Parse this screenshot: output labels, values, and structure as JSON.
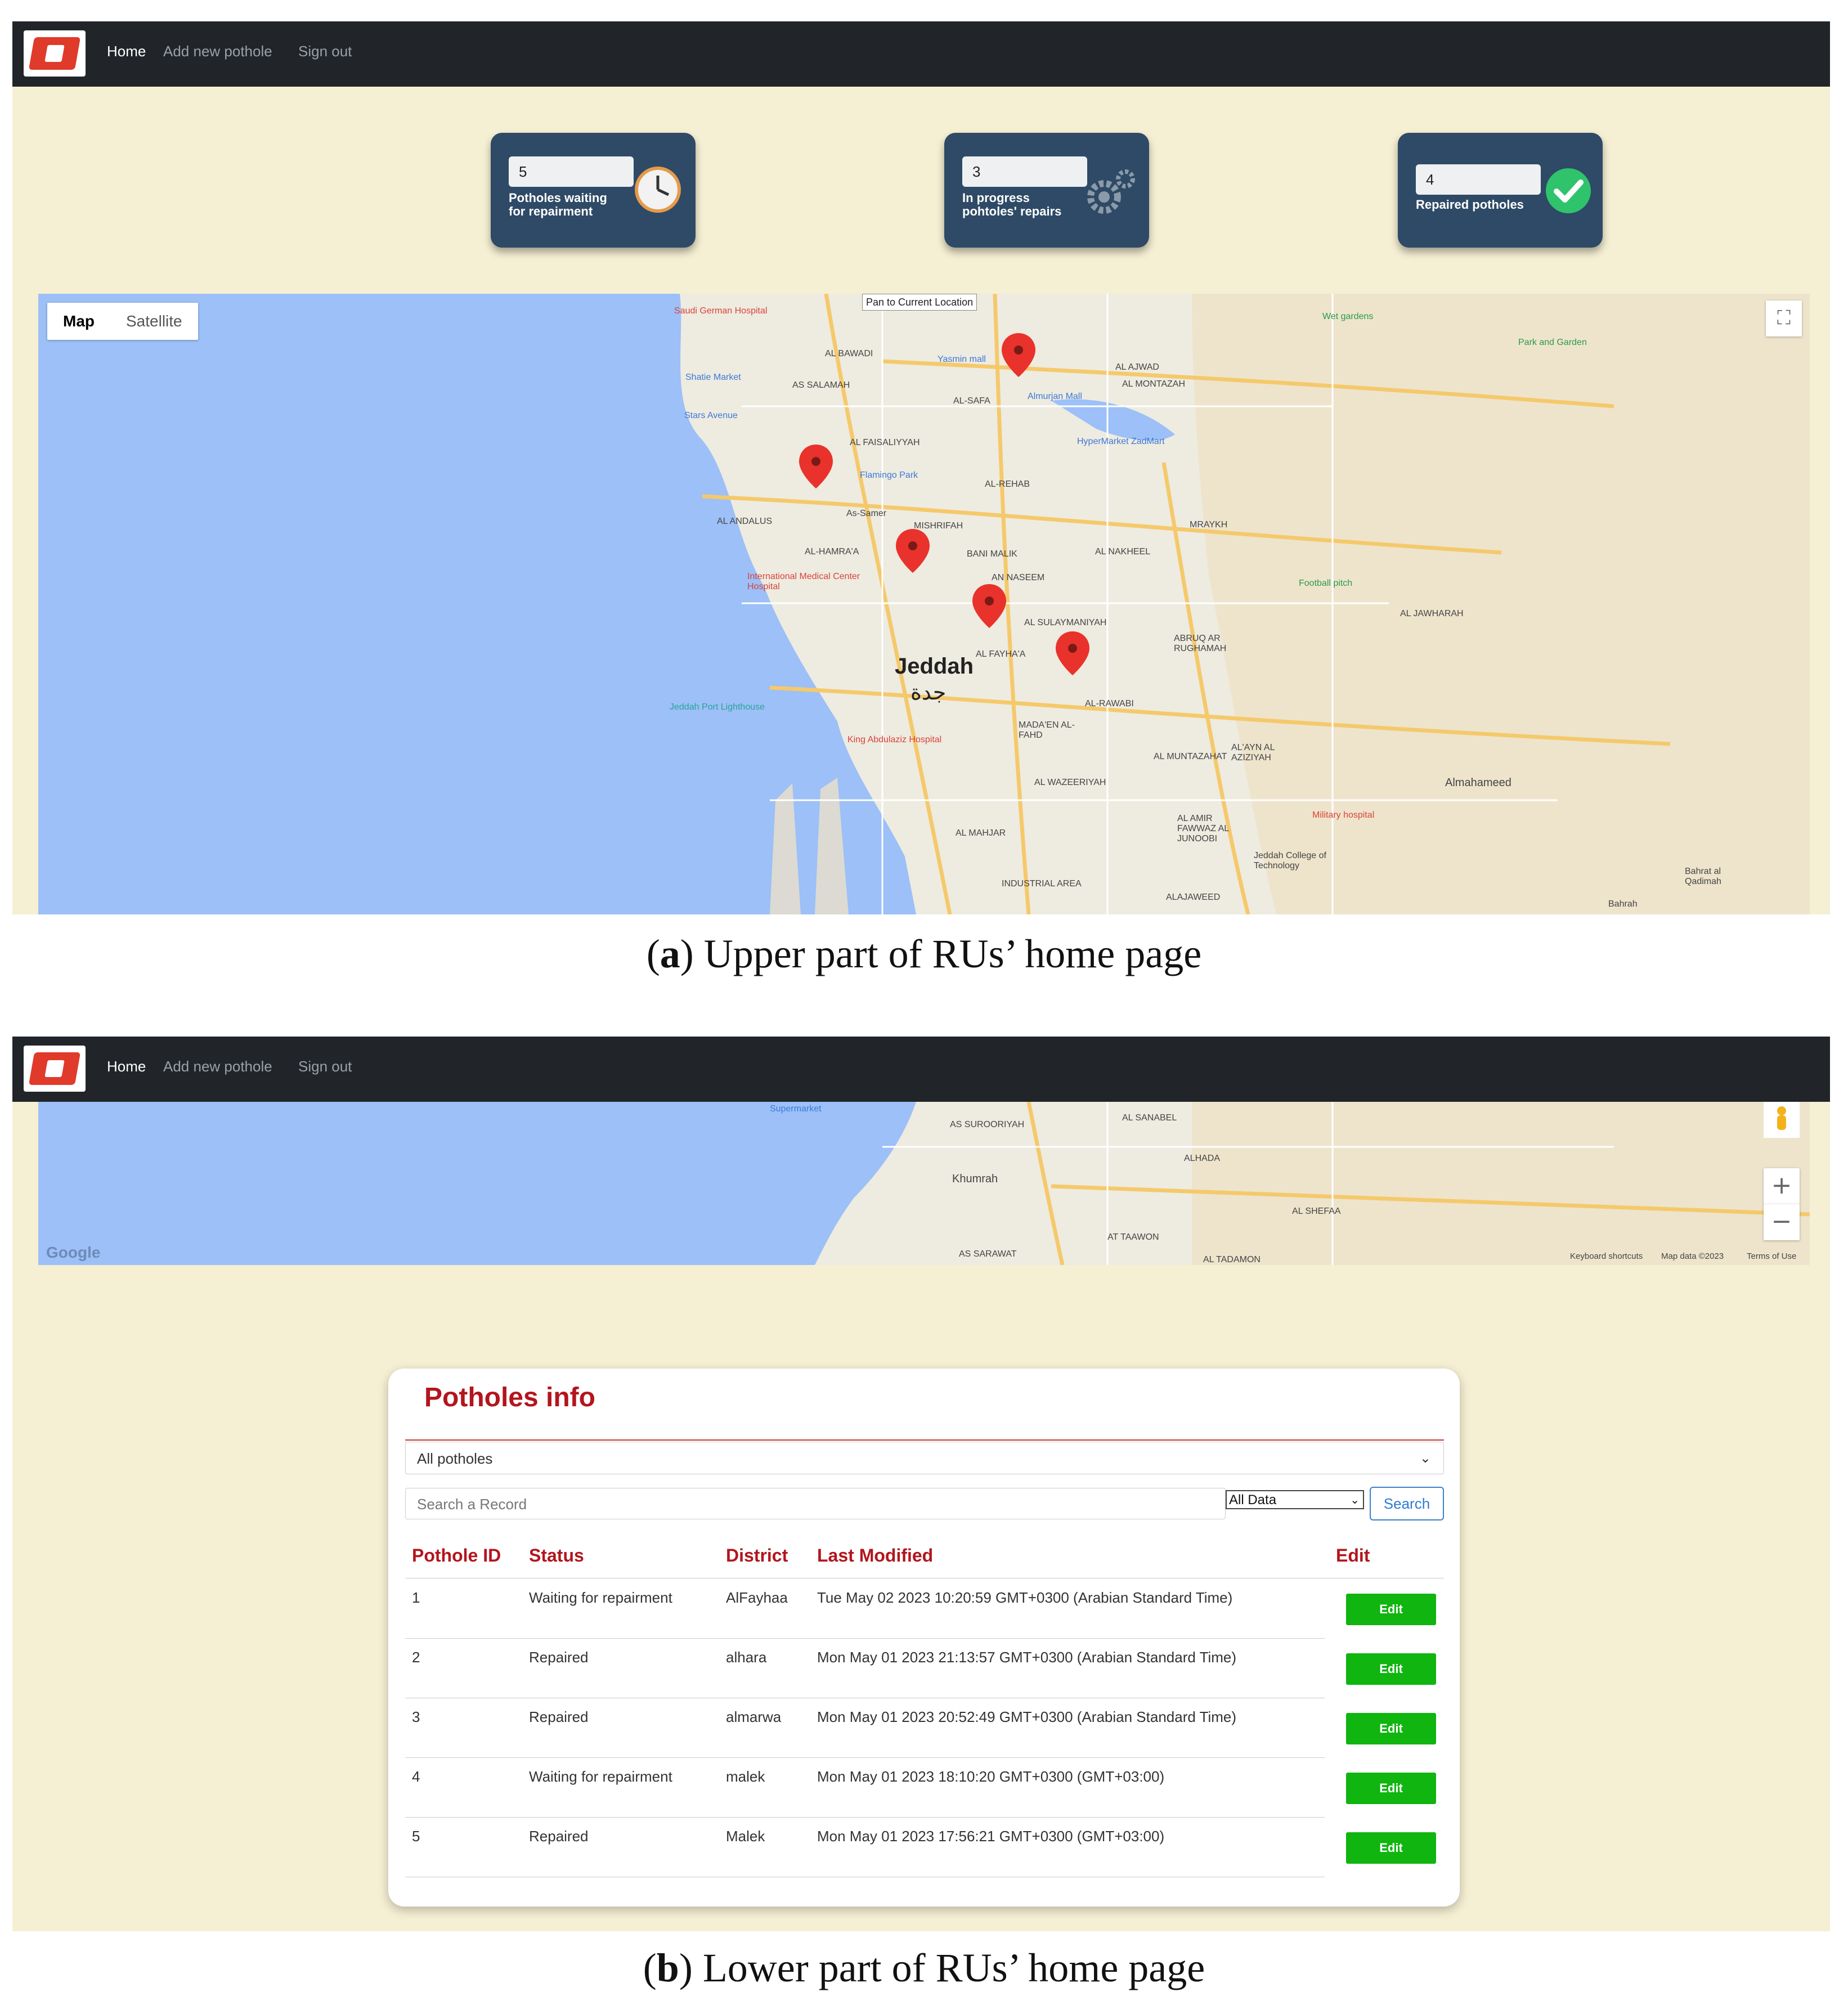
{
  "nav": {
    "home": "Home",
    "add": "Add new pothole",
    "signout": "Sign out"
  },
  "cards": [
    {
      "count": "5",
      "label": "Potholes waiting for repairment",
      "icon": "clock-icon"
    },
    {
      "count": "3",
      "label": "In progress pohtoles' repairs",
      "icon": "gears-icon"
    },
    {
      "count": "4",
      "label": "Repaired potholes",
      "icon": "check-icon"
    }
  ],
  "map": {
    "type_map": "Map",
    "type_satellite": "Satellite",
    "pan_label": "Pan to Current Location",
    "city_en": "Jeddah",
    "city_ar": "جدة",
    "places": [
      "Saudi German Hospital",
      "Shatie Market",
      "Stars Avenue",
      "AL BAWADI",
      "AS SALAMAH",
      "Yasmin mall",
      "Almurjan Mall",
      "AL-SAFA",
      "AL FAISALIYYAH",
      "Flamingo Park",
      "AL-REHAB",
      "HyperMarket ZadMart",
      "As-Samer",
      "AL ANDALUS",
      "MISHRIFAH",
      "AL-HAMRA'A",
      "International Medical Center Hospital",
      "AN NASEEM",
      "BANI MALIK",
      "AL SULAYMANIYAH",
      "AL FAYHA'A",
      "Jeddah Port Lighthouse",
      "AL-RAWABI",
      "MADA'EN AL-FAHD",
      "King Abdulaziz Hospital",
      "AL WAZEERIYAH",
      "AL MAHJAR",
      "INDUSTRIAL AREA",
      "Almahameed",
      "Jeddah College of Technology",
      "Military hospital",
      "Bahrat al Qadimah",
      "Bahrah",
      "Wet gardens",
      "Park and Garden",
      "Football pitch",
      "AL AJWAD",
      "AL MONTAZAH",
      "MRAYKH",
      "AL NAKHEEL",
      "AL MUNTAZAHAT",
      "AL'AYN AL AZIZIYAH",
      "ABRUQ AR RUGHAMAH",
      "AL JAWHARAH",
      "AL AMIR FAWWAZ AL JUNOOBI",
      "ALAJAWEED"
    ],
    "lower_places": [
      "Supermarket",
      "AS SUROORIYAH",
      "Khumrah",
      "AS SARAWAT",
      "AL SANABEL",
      "ALHADA",
      "AL SHEFAA",
      "AT TAAWON",
      "AL TADAMON"
    ],
    "google": "Google",
    "footer_shortcuts": "Keyboard shortcuts",
    "footer_data": "Map data ©2023",
    "footer_terms": "Terms of Use",
    "zoom_in": "+",
    "zoom_out": "−",
    "pin_color": "#e8322b"
  },
  "captions": {
    "a_letter": "a",
    "a_text": " Upper part of RUs’ home page",
    "b_letter": "b",
    "b_text": " Lower part of RUs’ home page"
  },
  "info": {
    "title": "Potholes info",
    "select_value": "All potholes",
    "search_placeholder": "Search a Record",
    "filter_value": "All Data",
    "search_button": "Search",
    "columns": [
      "Pothole ID",
      "Status",
      "District",
      "Last Modified",
      "Edit"
    ],
    "rows": [
      {
        "id": "1",
        "status": "Waiting for repairment",
        "district": "AlFayhaa",
        "modified": "Tue May 02 2023 10:20:59 GMT+0300 (Arabian Standard Time)",
        "edit": "Edit"
      },
      {
        "id": "2",
        "status": "Repaired",
        "district": "alhara",
        "modified": "Mon May 01 2023 21:13:57 GMT+0300 (Arabian Standard Time)",
        "edit": "Edit"
      },
      {
        "id": "3",
        "status": "Repaired",
        "district": "almarwa",
        "modified": "Mon May 01 2023 20:52:49 GMT+0300 (Arabian Standard Time)",
        "edit": "Edit"
      },
      {
        "id": "4",
        "status": "Waiting for repairment",
        "district": "malek",
        "modified": "Mon May 01 2023 18:10:20 GMT+0300 (GMT+03:00)",
        "edit": "Edit"
      },
      {
        "id": "5",
        "status": "Repaired",
        "district": "Malek",
        "modified": "Mon May 01 2023 17:56:21 GMT+0300 (GMT+03:00)",
        "edit": "Edit"
      }
    ]
  },
  "colors": {
    "navbar": "#212529",
    "page_bg": "#f5efd3",
    "card_bg": "#2e4a66",
    "accent_red": "#b3151d",
    "edit_green": "#10b510",
    "search_blue": "#2f7bd0"
  }
}
